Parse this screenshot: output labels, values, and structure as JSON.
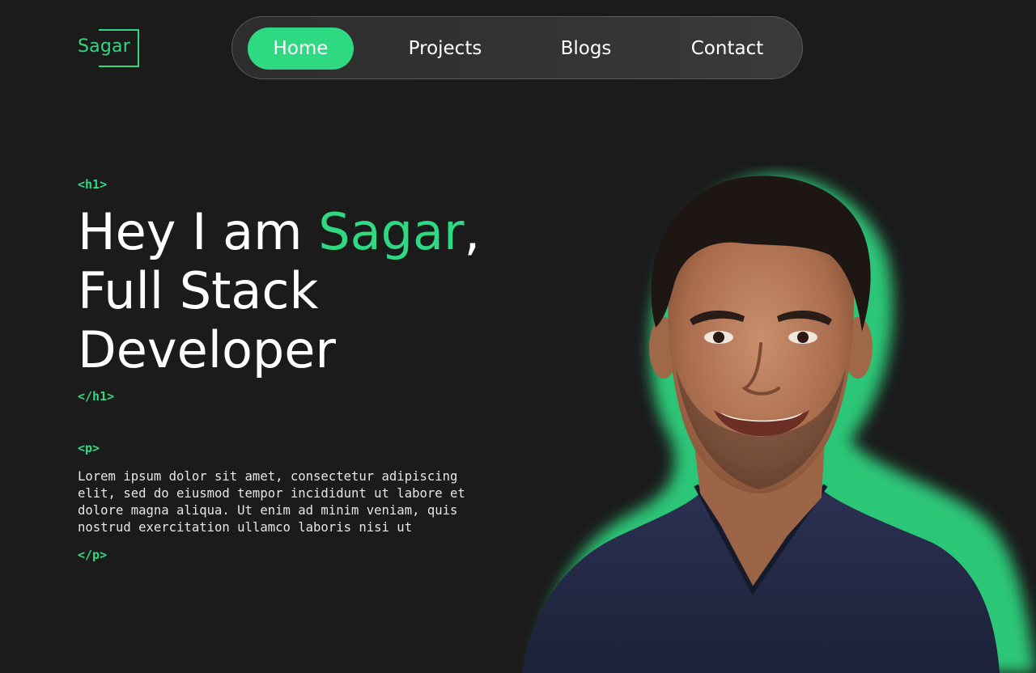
{
  "logo": {
    "text": "Sagar"
  },
  "nav": {
    "items": [
      {
        "label": "Home",
        "active": true
      },
      {
        "label": "Projects",
        "active": false
      },
      {
        "label": "Blogs",
        "active": false
      },
      {
        "label": "Contact",
        "active": false
      }
    ]
  },
  "hero": {
    "h1_open_tag": "<h1>",
    "h1_close_tag": "</h1>",
    "headline_prefix": "Hey I am ",
    "headline_name": "Sagar",
    "headline_comma": ",",
    "headline_line2": "Full Stack",
    "headline_line3": "Developer",
    "p_open_tag": "<p>",
    "p_close_tag": "</p>",
    "paragraph": "Lorem ipsum dolor sit amet, consectetur adipiscing elit, sed do eiusmod tempor incididunt ut labore et dolore magna aliqua. Ut enim ad minim veniam, quis nostrud exercitation ullamco laboris nisi ut"
  },
  "theme": {
    "accent": "#2fd982",
    "background": "#1b1b1b",
    "nav_background": "#333333"
  }
}
